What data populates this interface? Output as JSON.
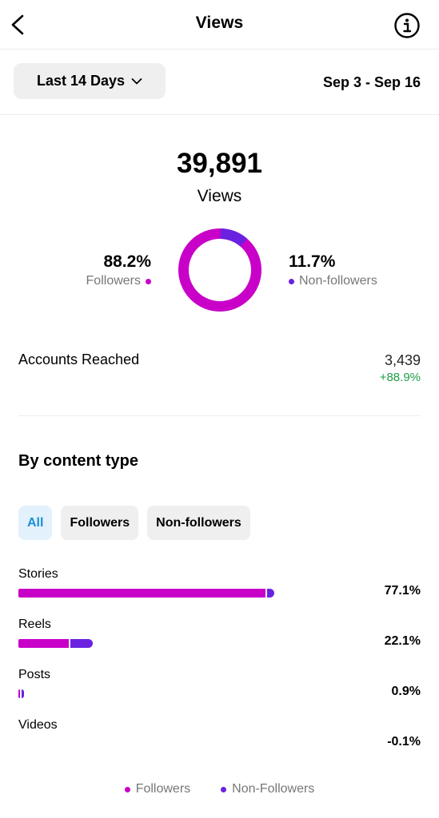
{
  "colors": {
    "followers": "#c800c8",
    "non_followers": "#6a22e0",
    "positive": "#1f9d46"
  },
  "header": {
    "title": "Views",
    "back_icon": "chevron-left-icon",
    "info_icon": "info-icon"
  },
  "filter": {
    "range_label": "Last 14 Days",
    "range_icon": "chevron-down-icon",
    "date_range": "Sep 3 - Sep 16"
  },
  "summary": {
    "total": "39,891",
    "total_label": "Views",
    "followers_pct": "88.2%",
    "followers_label": "Followers",
    "followers_fraction": 0.882,
    "non_followers_pct": "11.7%",
    "non_followers_label": "Non-followers",
    "non_followers_fraction": 0.117
  },
  "accounts_reached": {
    "label": "Accounts Reached",
    "value": "3,439",
    "change": "+88.9%"
  },
  "content_type": {
    "title": "By content type",
    "filters": [
      "All",
      "Followers",
      "Non-followers"
    ],
    "selected_filter": "All",
    "rows": [
      {
        "label": "Stories",
        "pct": "77.1%",
        "total": 77.1,
        "followers": 75.0,
        "non_followers": 2.1
      },
      {
        "label": "Reels",
        "pct": "22.1%",
        "total": 22.1,
        "followers": 15.4,
        "non_followers": 6.7
      },
      {
        "label": "Posts",
        "pct": "0.9%",
        "total": 0.9,
        "followers": 0.5,
        "non_followers": 0.4
      },
      {
        "label": "Videos",
        "pct": "-0.1%",
        "total": -0.1,
        "followers": 0,
        "non_followers": 0
      }
    ]
  },
  "legend": {
    "followers": "Followers",
    "non_followers": "Non-Followers"
  }
}
